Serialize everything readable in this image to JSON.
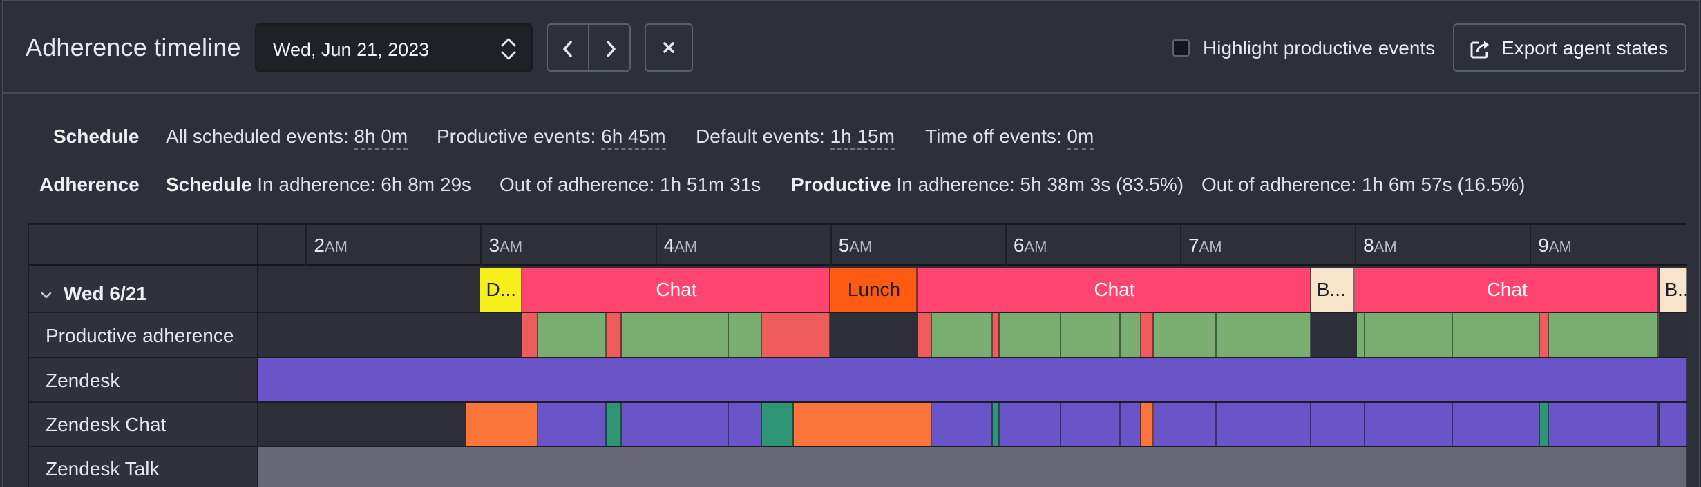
{
  "header": {
    "title": "Adherence timeline",
    "date_value": "Wed, Jun 21, 2023",
    "highlight_label": "Highlight productive events",
    "highlight_checked": false,
    "export_label": "Export agent states"
  },
  "schedule": {
    "label": "Schedule",
    "all_prefix": "All scheduled events: ",
    "all_value": "8h 0m",
    "productive_prefix": "Productive events: ",
    "productive_value": "6h 45m",
    "default_prefix": "Default events: ",
    "default_value": "1h 15m",
    "timeoff_prefix": "Time off events: ",
    "timeoff_value": "0m"
  },
  "adherence": {
    "label": "Adherence",
    "schedule_bold": "Schedule",
    "schedule_in": " In adherence: 6h 8m 29s",
    "schedule_out": "Out of adherence: 1h 51m 31s",
    "productive_bold": "Productive",
    "productive_in": " In adherence: 5h 38m 3s (83.5%)",
    "productive_out": "Out of adherence: 1h 6m 57s (16.5%)"
  },
  "timeline": {
    "hours": [
      {
        "num": "2",
        "suffix": "AM"
      },
      {
        "num": "3",
        "suffix": "AM"
      },
      {
        "num": "4",
        "suffix": "AM"
      },
      {
        "num": "5",
        "suffix": "AM"
      },
      {
        "num": "6",
        "suffix": "AM"
      },
      {
        "num": "7",
        "suffix": "AM"
      },
      {
        "num": "8",
        "suffix": "AM"
      },
      {
        "num": "9",
        "suffix": "AM"
      }
    ],
    "start_hour": 1.73,
    "end_hour": 9.9,
    "colors": {
      "schedule_yellow": "#f6ef1c",
      "chat_pink": "#ff4470",
      "lunch_orange": "#ff5a11",
      "break_cream": "#f6e4cb",
      "adherent_green": "#7aae70",
      "nonadherent_red": "#f05b5b",
      "zendesk_purple": "#6a55c8",
      "away_orange": "#fb743a",
      "teal": "#2e9575",
      "talk_gray": "#676876"
    },
    "day_label": "Wed 6/21",
    "rows": [
      {
        "label": "Productive adherence",
        "segments": [
          {
            "start": 3.24,
            "end": 3.33,
            "color": "nonadherent_red"
          },
          {
            "start": 3.33,
            "end": 3.72,
            "color": "adherent_green"
          },
          {
            "start": 3.72,
            "end": 3.81,
            "color": "nonadherent_red"
          },
          {
            "start": 3.81,
            "end": 4.42,
            "color": "adherent_green"
          },
          {
            "start": 4.42,
            "end": 4.61,
            "color": "adherent_green"
          },
          {
            "start": 4.61,
            "end": 5.0,
            "color": "nonadherent_red"
          },
          {
            "start": 5.5,
            "end": 5.58,
            "color": "nonadherent_red"
          },
          {
            "start": 5.58,
            "end": 5.93,
            "color": "adherent_green"
          },
          {
            "start": 5.93,
            "end": 5.97,
            "color": "nonadherent_red"
          },
          {
            "start": 5.97,
            "end": 6.32,
            "color": "adherent_green"
          },
          {
            "start": 6.32,
            "end": 6.66,
            "color": "adherent_green"
          },
          {
            "start": 6.66,
            "end": 6.78,
            "color": "adherent_green"
          },
          {
            "start": 6.78,
            "end": 6.85,
            "color": "nonadherent_red"
          },
          {
            "start": 6.85,
            "end": 7.21,
            "color": "adherent_green"
          },
          {
            "start": 7.21,
            "end": 7.75,
            "color": "adherent_green"
          },
          {
            "start": 8.01,
            "end": 8.06,
            "color": "adherent_green"
          },
          {
            "start": 8.06,
            "end": 8.56,
            "color": "adherent_green"
          },
          {
            "start": 8.56,
            "end": 9.06,
            "color": "adherent_green"
          },
          {
            "start": 9.06,
            "end": 9.11,
            "color": "nonadherent_red"
          },
          {
            "start": 9.11,
            "end": 9.74,
            "color": "adherent_green"
          }
        ]
      },
      {
        "label": "Zendesk",
        "segments": [
          {
            "start": 1.73,
            "end": 9.9,
            "color": "zendesk_purple"
          }
        ]
      },
      {
        "label": "Zendesk Chat",
        "segments": [
          {
            "start": 2.92,
            "end": 3.33,
            "color": "away_orange"
          },
          {
            "start": 3.33,
            "end": 3.72,
            "color": "zendesk_purple"
          },
          {
            "start": 3.72,
            "end": 3.81,
            "color": "teal"
          },
          {
            "start": 3.81,
            "end": 4.42,
            "color": "zendesk_purple"
          },
          {
            "start": 4.42,
            "end": 4.61,
            "color": "zendesk_purple"
          },
          {
            "start": 4.61,
            "end": 4.79,
            "color": "teal"
          },
          {
            "start": 4.79,
            "end": 5.58,
            "color": "away_orange"
          },
          {
            "start": 5.58,
            "end": 5.93,
            "color": "zendesk_purple"
          },
          {
            "start": 5.93,
            "end": 5.97,
            "color": "teal"
          },
          {
            "start": 5.97,
            "end": 6.32,
            "color": "zendesk_purple"
          },
          {
            "start": 6.32,
            "end": 6.66,
            "color": "zendesk_purple"
          },
          {
            "start": 6.66,
            "end": 6.78,
            "color": "zendesk_purple"
          },
          {
            "start": 6.78,
            "end": 6.85,
            "color": "away_orange"
          },
          {
            "start": 6.85,
            "end": 7.21,
            "color": "zendesk_purple"
          },
          {
            "start": 7.21,
            "end": 7.75,
            "color": "zendesk_purple"
          },
          {
            "start": 7.75,
            "end": 8.06,
            "color": "zendesk_purple"
          },
          {
            "start": 8.06,
            "end": 8.56,
            "color": "zendesk_purple"
          },
          {
            "start": 8.56,
            "end": 9.06,
            "color": "zendesk_purple"
          },
          {
            "start": 9.06,
            "end": 9.11,
            "color": "teal"
          },
          {
            "start": 9.11,
            "end": 9.74,
            "color": "zendesk_purple"
          },
          {
            "start": 9.74,
            "end": 9.9,
            "color": "zendesk_purple"
          }
        ]
      },
      {
        "label": "Zendesk Talk",
        "segments": [
          {
            "start": 1.73,
            "end": 9.9,
            "color": "talk_gray"
          }
        ]
      }
    ],
    "schedule": [
      {
        "start": 3.0,
        "end": 3.24,
        "color": "schedule_yellow",
        "label": "D...",
        "align": "left"
      },
      {
        "start": 3.24,
        "end": 5.0,
        "color": "chat_pink",
        "label": "Chat",
        "light": true
      },
      {
        "start": 5.0,
        "end": 5.5,
        "color": "lunch_orange",
        "label": "Lunch"
      },
      {
        "start": 5.5,
        "end": 7.75,
        "color": "chat_pink",
        "label": "Chat",
        "light": true
      },
      {
        "start": 7.75,
        "end": 8.0,
        "color": "break_cream",
        "label": "B...",
        "align": "left"
      },
      {
        "start": 8.0,
        "end": 9.74,
        "color": "chat_pink",
        "label": "Chat",
        "light": true
      },
      {
        "start": 9.74,
        "end": 9.9,
        "color": "break_cream",
        "label": "B...",
        "align": "left"
      }
    ]
  }
}
